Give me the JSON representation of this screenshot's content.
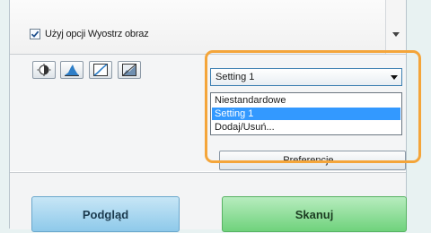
{
  "top": {
    "sharpen_checkbox": {
      "label": "Użyj opcji Wyostrz obraz",
      "checked": true
    }
  },
  "toolbar": {
    "icons": [
      "brightness-icon",
      "histogram-icon",
      "tone-curve-icon",
      "final-review-icon"
    ]
  },
  "combo": {
    "value": "Setting 1",
    "options": [
      {
        "label": "Niestandardowe",
        "selected": false
      },
      {
        "label": "Setting 1",
        "selected": true
      },
      {
        "label": "Dodaj/Usuń...",
        "selected": false
      }
    ]
  },
  "buttons": {
    "preferences": "Preferencje...",
    "preview": "Podgląd",
    "scan": "Skanuj"
  },
  "colors": {
    "highlight": "#f4a53a",
    "selection": "#3399ff",
    "preview_button": "#8ec9ea",
    "scan_button": "#6fd27c"
  }
}
